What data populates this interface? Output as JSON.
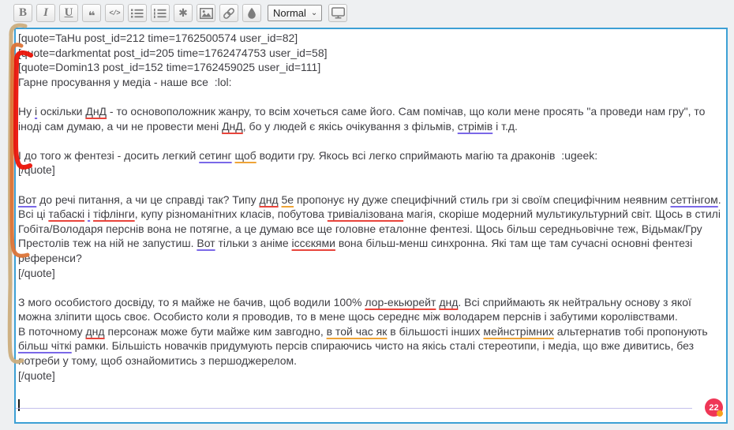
{
  "toolbar": {
    "buttons": [
      {
        "name": "bold",
        "glyph": "B"
      },
      {
        "name": "italic",
        "glyph": "I"
      },
      {
        "name": "underline",
        "glyph": "U"
      },
      {
        "name": "quote",
        "glyph": "❝"
      },
      {
        "name": "code",
        "glyph": "</>"
      },
      {
        "name": "unordered-list",
        "glyph": "list-bullets-icon"
      },
      {
        "name": "ordered-list",
        "glyph": "list-numbers-icon"
      },
      {
        "name": "list-item",
        "glyph": "✱"
      },
      {
        "name": "image",
        "glyph": "image-icon"
      },
      {
        "name": "link",
        "glyph": "link-chain-icon"
      },
      {
        "name": "font-color",
        "glyph": "droplet-icon"
      },
      {
        "name": "fullscreen",
        "glyph": "monitor-icon"
      }
    ],
    "format_select": {
      "value": "Normal"
    }
  },
  "editor": {
    "badge_count": "22",
    "lines": [
      {
        "segments": [
          [
            "[quote=TaHu post_id=212 time=1762500574 user_id=82]",
            ""
          ]
        ]
      },
      {
        "segments": [
          [
            "[quote=darkmentat post_id=205 time=1762474753 user_id=58]",
            ""
          ]
        ]
      },
      {
        "segments": [
          [
            "[quote=Domin13 post_id=152 time=1762459025 user_id=111]",
            ""
          ]
        ]
      },
      {
        "segments": [
          [
            "Гарне просування у медіа - наше все  :lol:",
            ""
          ]
        ]
      },
      {
        "segments": []
      },
      {
        "segments": [
          [
            "Ну ",
            ""
          ],
          [
            "і",
            "purple"
          ],
          [
            " оскільки ",
            ""
          ],
          [
            "ДнД",
            "red"
          ],
          [
            " - то основоположник жанру, то всім хочеться саме його. Сам помічав, що коли мене просять \"а проведи нам гру\", то іноді сам думаю, а чи не провести мені ",
            ""
          ],
          [
            "ДнД",
            "red"
          ],
          [
            ", бо у людей є якісь очікування з фільмів, ",
            ""
          ],
          [
            "стрімів",
            "purple"
          ],
          [
            " і т.д.",
            ""
          ]
        ]
      },
      {
        "segments": []
      },
      {
        "segments": [
          [
            "І до того ж фентезі - досить легкий ",
            ""
          ],
          [
            "сетинг",
            "purple"
          ],
          [
            " ",
            ""
          ],
          [
            "щоб",
            "orange"
          ],
          [
            " водити гру. Якось всі легко сприймають магію та драконів  :ugeek:",
            ""
          ]
        ]
      },
      {
        "segments": [
          [
            "[/quote]",
            ""
          ]
        ]
      },
      {
        "segments": []
      },
      {
        "segments": [
          [
            "Вот",
            "purple"
          ],
          [
            " до речі питання, а чи це справді так? Типу ",
            ""
          ],
          [
            "днд",
            "red"
          ],
          [
            " ",
            ""
          ],
          [
            "5е",
            "orange"
          ],
          [
            " пропонує ну дуже специфічний стиль гри зі своїм специфічним неявним ",
            ""
          ],
          [
            "сеттінгом",
            "purple"
          ],
          [
            ". Всі ці ",
            ""
          ],
          [
            "табаскі",
            "red"
          ],
          [
            " ",
            ""
          ],
          [
            "і",
            "purple"
          ],
          [
            " ",
            ""
          ],
          [
            "тіфлінги",
            "red"
          ],
          [
            ", купу різноманітних класів, побутова ",
            ""
          ],
          [
            "тривіалізована",
            "red"
          ],
          [
            " магія, скоріше модерний мультикультурний світ. Щось в стилі Гобіта/Володаря перснів вона не потягне, а це думаю все ще головне еталонне фентезі. Щось більш середньовічне теж, Відьмак/Гру Престолів теж на ній не запустиш. ",
            ""
          ],
          [
            "Вот",
            "purple"
          ],
          [
            " тільки з аніме ",
            ""
          ],
          [
            "іссєкями",
            "red"
          ],
          [
            " вона більш-менш синхронна. Які там ще там сучасні основні фентезі референси?",
            ""
          ]
        ]
      },
      {
        "segments": [
          [
            "[/quote]",
            ""
          ]
        ]
      },
      {
        "segments": []
      },
      {
        "segments": [
          [
            "З мого особистого досвіду, то я майже не бачив, щоб водили 100% ",
            ""
          ],
          [
            "лор-екьюрейт",
            "red"
          ],
          [
            " ",
            ""
          ],
          [
            "днд",
            "red"
          ],
          [
            ". Всі сприймають як нейтральну основу з якої можна зліпити щось своє. Особисто коли я проводив, то в мене щось середнє між володарем перснів і забутими королівствами.",
            ""
          ]
        ]
      },
      {
        "segments": [
          [
            "В поточному ",
            ""
          ],
          [
            "днд",
            "red"
          ],
          [
            " персонаж може бути майже ким завгодно, ",
            ""
          ],
          [
            "в той час як",
            "orange"
          ],
          [
            " в більшості інших ",
            ""
          ],
          [
            "мейнстрімних",
            "orange"
          ],
          [
            " альтернатив тобі пропонують ",
            ""
          ],
          [
            "більш чіткі",
            "purple"
          ],
          [
            " рамки. Більшість новачків придумують персів спираючись чисто на якісь сталі стереотипи, і медіа, що вже дивитись, без потреби у тому, щоб ознайомитись з першоджерелом.",
            ""
          ]
        ]
      },
      {
        "segments": [
          [
            "[/quote]",
            ""
          ]
        ]
      },
      {
        "segments": []
      },
      {
        "segments": [],
        "caret": true
      }
    ]
  },
  "colors": {
    "editor_border": "#3da0d5",
    "underline_red": "#e8453c",
    "underline_purple": "#7a68e8",
    "underline_orange": "#efa437",
    "badge": "#ef3656",
    "badge_dot": "#f6a21e",
    "bracket_outer": "#cbad7d",
    "bracket_middle": "#dc7437",
    "bracket_inner": "#ec1408"
  }
}
